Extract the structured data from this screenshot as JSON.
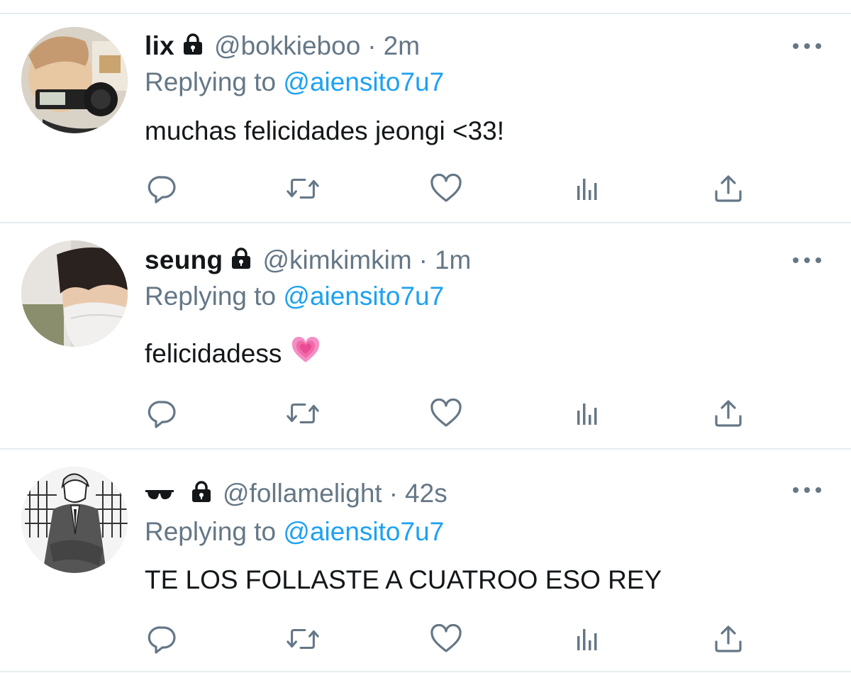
{
  "tweets": [
    {
      "name": "lix",
      "handle": "@bokkieboo",
      "separator": "·",
      "time": "2m",
      "reply_prefix": "Replying to",
      "reply_to": "@aiensito7u7",
      "text": "muchas felicidades jeongi <33!",
      "locked": true
    },
    {
      "name": "seung",
      "handle": "@kimkimkim",
      "separator": "·",
      "time": "1m",
      "reply_prefix": "Replying to",
      "reply_to": "@aiensito7u7",
      "text": "felicidadess",
      "text_emoji": "growing-heart-icon",
      "locked": true
    },
    {
      "name": "",
      "name_emoji": "sunglasses-icon",
      "handle": "@follamelight",
      "separator": "·",
      "time": "42s",
      "reply_prefix": "Replying to",
      "reply_to": "@aiensito7u7",
      "text": "TE LOS FOLLASTE A CUATROO ESO REY",
      "locked": true
    }
  ],
  "actions": [
    "reply-icon",
    "retweet-icon",
    "like-icon",
    "analytics-icon",
    "share-icon"
  ],
  "colors": {
    "text": "#14171a",
    "secondary": "#657786",
    "link": "#1da1f2",
    "divider": "#e6ecf0"
  }
}
